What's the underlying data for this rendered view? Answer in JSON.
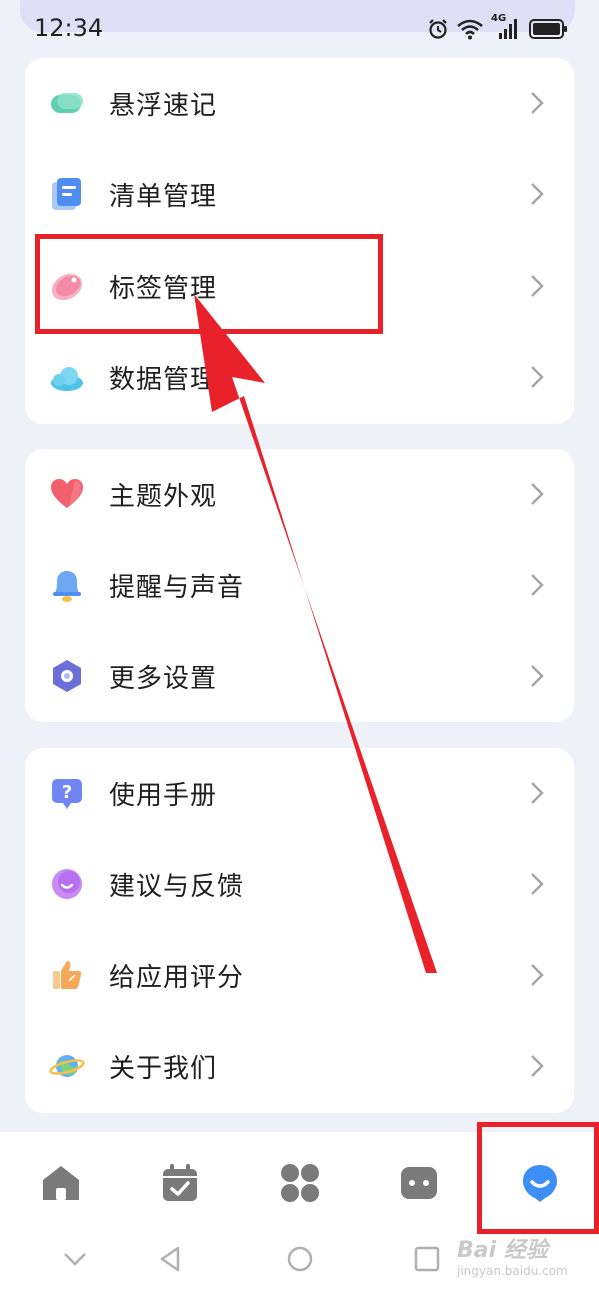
{
  "status_bar": {
    "time": "12:34",
    "network": "4G"
  },
  "groups": [
    {
      "items": [
        {
          "label": "悬浮速记",
          "icon": "floating-note-icon"
        },
        {
          "label": "清单管理",
          "icon": "list-icon"
        },
        {
          "label": "标签管理",
          "icon": "tag-icon"
        },
        {
          "label": "数据管理",
          "icon": "cloud-icon"
        }
      ]
    },
    {
      "items": [
        {
          "label": "主题外观",
          "icon": "heart-icon"
        },
        {
          "label": "提醒与声音",
          "icon": "bell-icon"
        },
        {
          "label": "更多设置",
          "icon": "hexagon-gear-icon"
        }
      ]
    },
    {
      "items": [
        {
          "label": "使用手册",
          "icon": "help-icon"
        },
        {
          "label": "建议与反馈",
          "icon": "feedback-icon"
        },
        {
          "label": "给应用评分",
          "icon": "thumbs-up-icon"
        },
        {
          "label": "关于我们",
          "icon": "planet-icon"
        }
      ]
    }
  ],
  "bottom_nav": {
    "items": [
      "home-icon",
      "calendar-icon",
      "grid-icon",
      "chat-icon",
      "profile-icon"
    ],
    "active_index": 4
  },
  "watermark": {
    "main": "Bai 经验",
    "sub": "jingyan.baidu.com"
  },
  "colors": {
    "annotation_red": "#e8212b",
    "active_nav": "#3d8ef5",
    "inactive_nav": "#7a7a7a"
  }
}
